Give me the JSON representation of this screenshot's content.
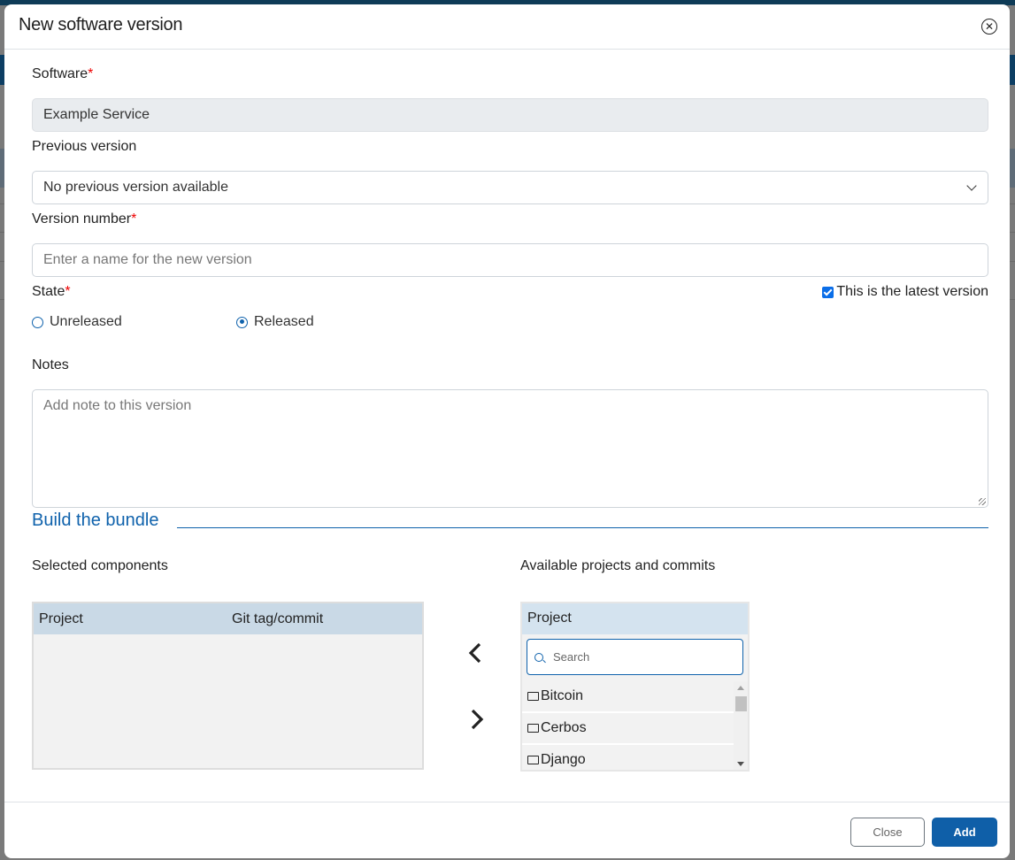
{
  "dialog": {
    "title": "New software version",
    "close_icon": "close-circle-icon"
  },
  "form": {
    "software": {
      "label": "Software",
      "required_mark": "*",
      "value": "Example Service"
    },
    "previous_version": {
      "label": "Previous version",
      "value": "No previous version available"
    },
    "version_number": {
      "label": "Version number",
      "required_mark": "*",
      "placeholder": "Enter a name for the new version"
    },
    "state": {
      "label": "State",
      "required_mark": "*",
      "options": [
        {
          "label": "Unreleased",
          "selected": false
        },
        {
          "label": "Released",
          "selected": true
        }
      ]
    },
    "latest_version": {
      "label": "This is the latest version",
      "checked": true
    },
    "notes": {
      "label": "Notes",
      "placeholder": "Add note to this version"
    }
  },
  "bundle": {
    "title": "Build the bundle",
    "selected": {
      "label": "Selected components",
      "columns": [
        "Project",
        "Git tag/commit"
      ],
      "rows": []
    },
    "available": {
      "label": "Available projects and commits",
      "column": "Project",
      "search_placeholder": "Search",
      "items": [
        "Bitcoin",
        "Cerbos",
        "Django"
      ]
    },
    "move_left_icon": "chevron-left-icon",
    "move_right_icon": "chevron-right-icon"
  },
  "footer": {
    "close_label": "Close",
    "add_label": "Add"
  },
  "colors": {
    "accent": "#0f62ac",
    "required": "#e00000",
    "header_bg": "#c9d9e6"
  }
}
